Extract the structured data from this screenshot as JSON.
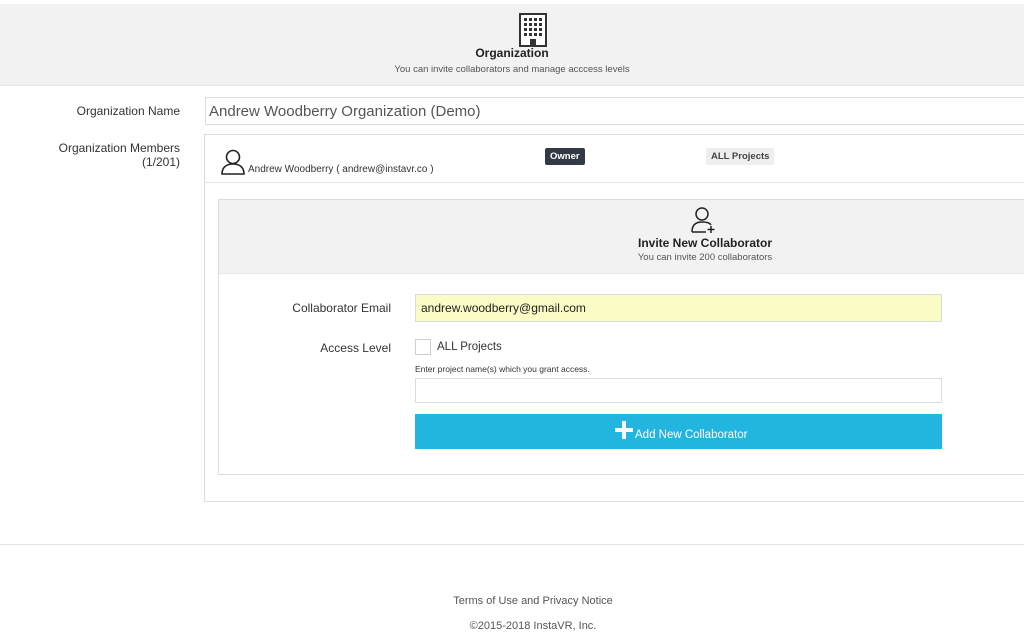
{
  "header": {
    "icon": "building-icon",
    "title": "Organization",
    "subtitle": "You can invite collaborators and manage acccess levels"
  },
  "form": {
    "org_name_label": "Organization Name",
    "org_name_value": "Andrew Woodberry Organization (Demo)",
    "members_label": "Organization Members (1/201)"
  },
  "members": [
    {
      "icon": "user-icon",
      "name": "Andrew Woodberry ( andrew@instavr.co )",
      "role": "Owner",
      "access": "ALL Projects"
    }
  ],
  "invite": {
    "icon": "add-user-icon",
    "title": "Invite New Collaborator",
    "subtitle": "You can invite 200 collaborators",
    "email_label": "Collaborator Email",
    "email_value": "andrew.woodberry@gmail.com",
    "access_label": "Access Level",
    "all_projects_label": "ALL Projects",
    "all_projects_checked": false,
    "project_hint": "Enter project name(s) which you grant access.",
    "project_value": "",
    "button_label": "Add New Collaborator",
    "button_color": "#22b5e0"
  },
  "footer": {
    "link": "Terms of Use and Privacy Notice",
    "copyright": "©2015-2018 InstaVR, Inc."
  }
}
